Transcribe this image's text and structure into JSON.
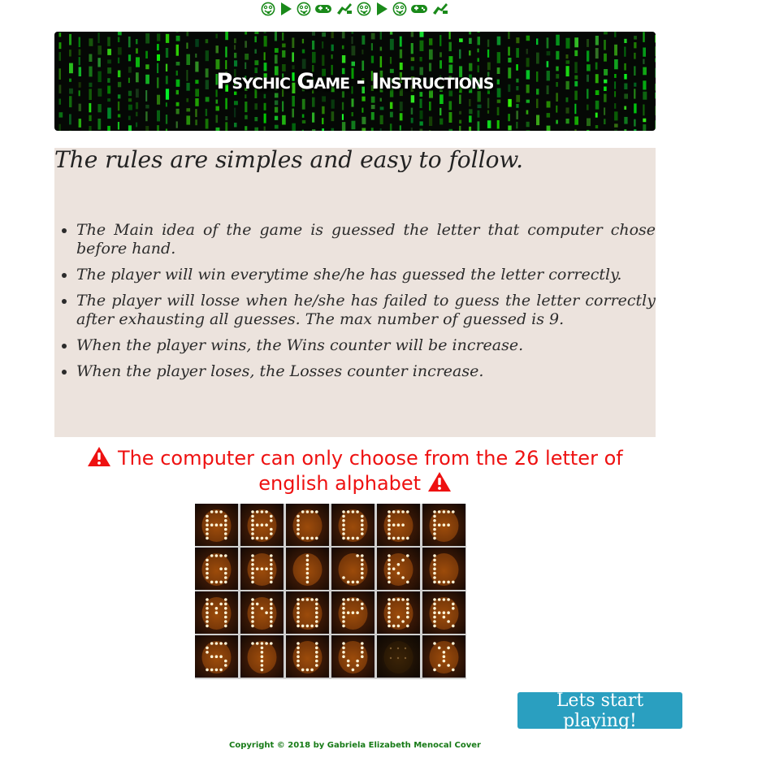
{
  "header": {
    "icons": [
      "crazy-face-icon",
      "play-icon",
      "crazy-face-icon",
      "gamepad-icon",
      "robot-hand-icon",
      "crazy-face-icon",
      "play-icon",
      "crazy-face-icon",
      "gamepad-icon",
      "robot-hand-icon"
    ],
    "banner_title": "Psychic Game - Instructions"
  },
  "rules": {
    "heading": "The rules are simples and easy to follow.",
    "items": [
      "The Main idea of the game is guessed the letter that computer chose before hand.",
      "The player will win everytime she/he has guessed the letter correctly.",
      "The player will losse when he/she has failed to guess the letter correctly after exhausting all guesses. The max number of guessed is 9.",
      "When the player wins, the Wins counter will be increase.",
      "When the player loses, the Losses counter increase."
    ]
  },
  "warning": {
    "line1": "The computer can only choose from the 26 letter of",
    "line2": "english alphabet",
    "icon": "warning-icon",
    "color": "#ee1111"
  },
  "letters_image": {
    "tiles": [
      "A",
      "B",
      "C",
      "D",
      "E",
      "F",
      "G",
      "H",
      "I",
      "J",
      "K",
      "L",
      "M",
      "N",
      "O",
      "P",
      "Q",
      "R",
      "S",
      "T",
      "U",
      "V",
      "",
      "X"
    ]
  },
  "actions": {
    "start_label": "Lets start playing!",
    "start_color": "#2a9fc0"
  },
  "footer": {
    "text": "Copyright © 2018 by Gabriela Elizabeth Menocal Cover",
    "color": "#167a16"
  }
}
